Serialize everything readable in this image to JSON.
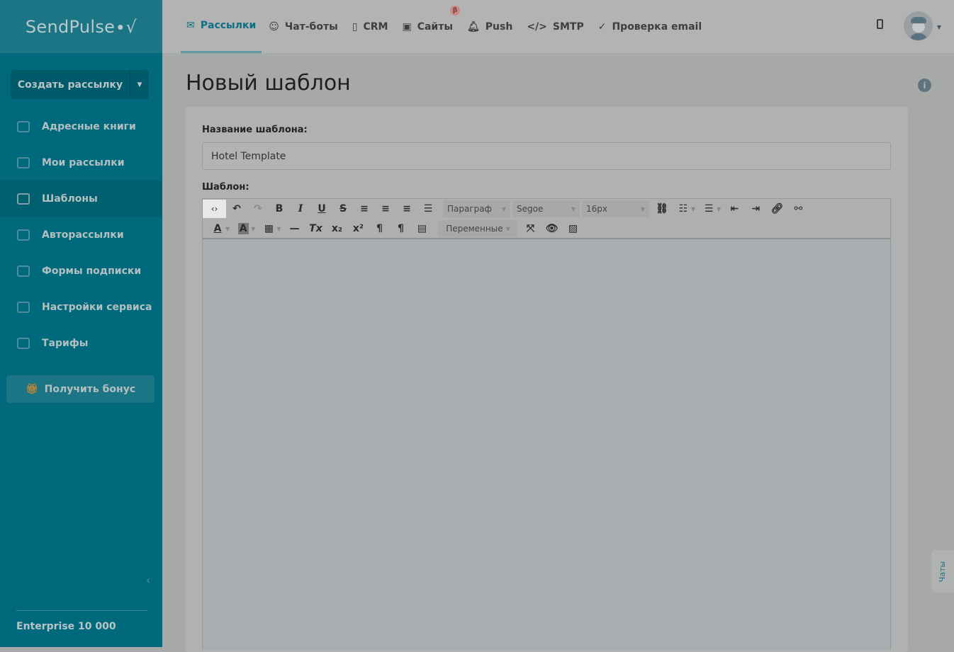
{
  "brand": "SendPulse",
  "sidebar": {
    "create_label": "Создать рассылку",
    "items": [
      {
        "label": "Адресные книги",
        "icon": "address-book-icon"
      },
      {
        "label": "Мои рассылки",
        "icon": "upload-icon"
      },
      {
        "label": "Шаблоны",
        "icon": "template-icon",
        "active": true
      },
      {
        "label": "Авторассылки",
        "icon": "automation-icon"
      },
      {
        "label": "Формы подписки",
        "icon": "form-icon"
      },
      {
        "label": "Настройки сервиса",
        "icon": "settings-sliders-icon"
      },
      {
        "label": "Тарифы",
        "icon": "wallet-icon"
      }
    ],
    "bonus_label": "Получить бонус",
    "plan": "Enterprise 10 000"
  },
  "topnav": {
    "tabs": [
      {
        "label": "Рассылки",
        "icon": "✉",
        "active": true
      },
      {
        "label": "Чат-боты",
        "icon": "☺"
      },
      {
        "label": "CRM",
        "icon": "▯"
      },
      {
        "label": "Сайты",
        "icon": "▣",
        "badge": "β"
      },
      {
        "label": "Push",
        "icon": "♫"
      },
      {
        "label": "SMTP",
        "icon": "</>"
      },
      {
        "label": "Проверка email",
        "icon": "✓"
      }
    ]
  },
  "page": {
    "title": "Новый шаблон",
    "name_label": "Название шаблона:",
    "name_value": "Hotel Template",
    "template_label": "Шаблон:"
  },
  "toolbar": {
    "paragraph": "Параграф",
    "font": "Segoe",
    "size": "16px",
    "variables": "Переменные"
  },
  "chats_label": "Чаты"
}
